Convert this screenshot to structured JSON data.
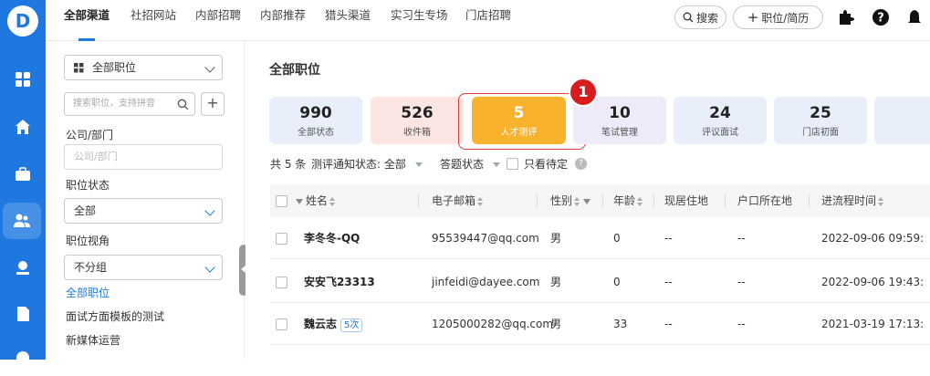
{
  "nav": {
    "tabs": [
      "全部渠道",
      "社招网站",
      "内部招聘",
      "内部推荐",
      "猎头渠道",
      "实习生专场",
      "门店招聘"
    ],
    "search_label": "搜索",
    "add_label": "职位/简历"
  },
  "filter": {
    "scope_select": "全部职位",
    "search_placeholder": "搜索职位，支持拼音",
    "company_label": "公司/部门",
    "company_placeholder": "公司/部门",
    "status_label": "职位状态",
    "status_value": "全部",
    "view_label": "职位视角",
    "view_value": "不分组",
    "positions": [
      "全部职位",
      "面试方面模板的测试",
      "新媒体运营"
    ]
  },
  "main": {
    "title": "全部职位",
    "cards": [
      {
        "count": "990",
        "label": "全部状态"
      },
      {
        "count": "526",
        "label": "收件箱"
      },
      {
        "count": "5",
        "label": "人才测评"
      },
      {
        "count": "10",
        "label": "笔试管理"
      },
      {
        "count": "24",
        "label": "评议面试"
      },
      {
        "count": "25",
        "label": "门店初面"
      }
    ],
    "step_badge": "1",
    "summary": {
      "total": "共 5 条",
      "notify_label": "测评通知状态:",
      "notify_value": "全部",
      "answer_label": "答题状态",
      "pending_label": "只看待定"
    },
    "table": {
      "headers": [
        "姓名",
        "电子邮箱",
        "性别",
        "年龄",
        "现居住地",
        "户口所在地",
        "进流程时间"
      ],
      "rows": [
        {
          "name": "李冬冬-QQ",
          "tag": "",
          "email": "95539447@qq.com",
          "gender": "男",
          "age": "0",
          "residence": "--",
          "hukou": "--",
          "time": "2022-09-06 09:59:"
        },
        {
          "name": "安安飞23313",
          "tag": "",
          "email": "jinfeidi@dayee.com",
          "gender": "男",
          "age": "0",
          "residence": "--",
          "hukou": "--",
          "time": "2022-09-06 19:43:"
        },
        {
          "name": "魏云志",
          "tag": "5次",
          "email": "1205000282@qq.com",
          "gender": "男",
          "age": "33",
          "residence": "--",
          "hukou": "--",
          "time": "2021-03-19 17:13:"
        }
      ]
    }
  }
}
